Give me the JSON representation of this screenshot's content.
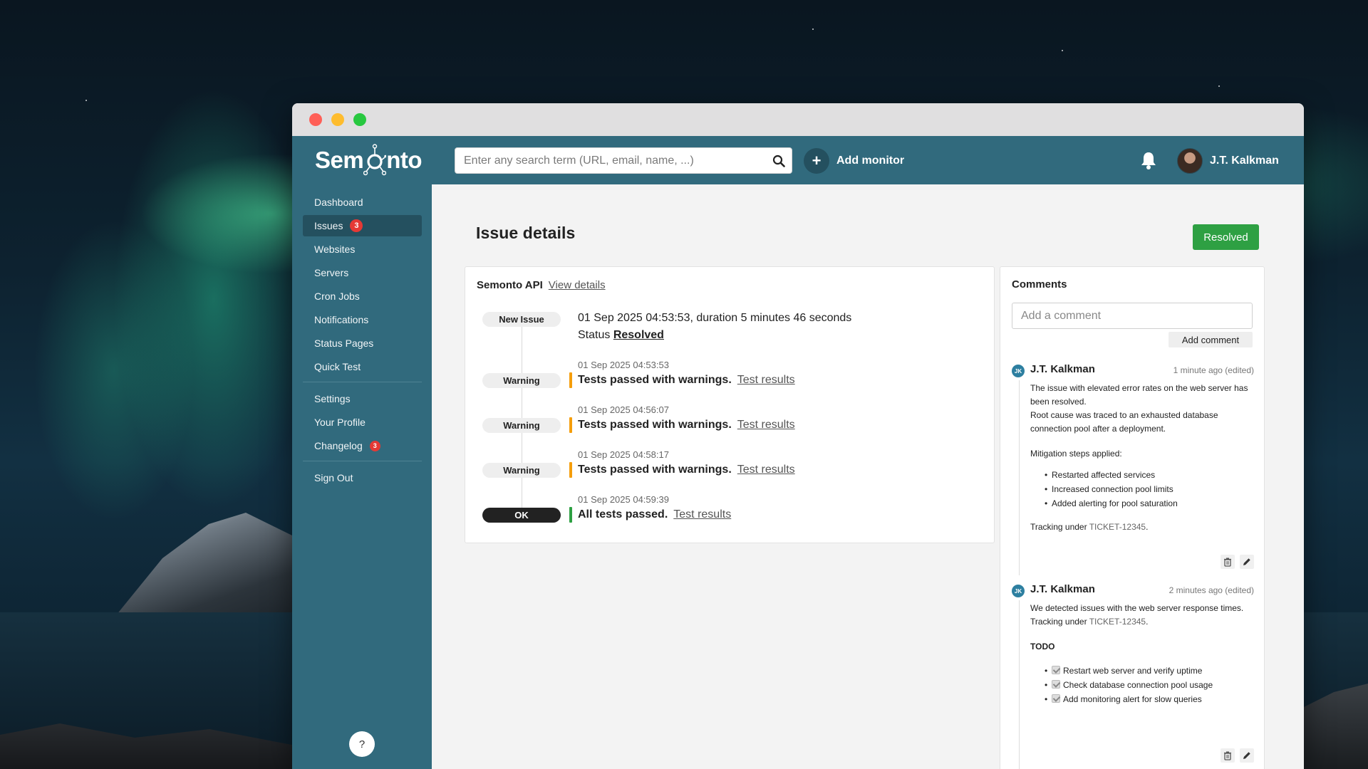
{
  "app": {
    "logo_text_left": "Sem",
    "logo_text_right": "nto"
  },
  "search": {
    "placeholder": "Enter any search term (URL, email, name, ...)",
    "value": ""
  },
  "header": {
    "add_monitor_label": "Add monitor",
    "user_name": "J.T. Kalkman"
  },
  "sidebar": {
    "items": [
      {
        "label": "Dashboard"
      },
      {
        "label": "Issues",
        "badge": "3"
      },
      {
        "label": "Websites"
      },
      {
        "label": "Servers"
      },
      {
        "label": "Cron Jobs"
      },
      {
        "label": "Notifications"
      },
      {
        "label": "Status Pages"
      },
      {
        "label": "Quick Test"
      },
      {
        "label": "Settings"
      },
      {
        "label": "Your Profile"
      },
      {
        "label": "Changelog",
        "badge": "3"
      },
      {
        "label": "Sign Out"
      }
    ],
    "help_label": "?"
  },
  "page": {
    "title": "Issue details",
    "status_button": "Resolved"
  },
  "issue": {
    "monitor_name": "Semonto API",
    "view_details": "View details",
    "header_event": {
      "label": "New Issue",
      "text": "01 Sep 2025 04:53:53, duration 5 minutes 46 seconds",
      "status_prefix": "Status",
      "status_value": "Resolved"
    },
    "events": [
      {
        "label": "Warning",
        "time": "01 Sep 2025 04:53:53",
        "message": "Tests passed with warnings.",
        "link": "Test results"
      },
      {
        "label": "Warning",
        "time": "01 Sep 2025 04:56:07",
        "message": "Tests passed with warnings.",
        "link": "Test results"
      },
      {
        "label": "Warning",
        "time": "01 Sep 2025 04:58:17",
        "message": "Tests passed with warnings.",
        "link": "Test results"
      },
      {
        "label": "OK",
        "time": "01 Sep 2025 04:59:39",
        "message": "All tests passed.",
        "link": "Test results"
      }
    ]
  },
  "comments": {
    "title": "Comments",
    "input_placeholder": "Add a comment",
    "add_button": "Add comment",
    "items": [
      {
        "initials": "JK",
        "author": "J.T. Kalkman",
        "time": "1 minute ago (edited)",
        "line1": "The issue with elevated error rates on the web server has been resolved.",
        "line2": "Root cause was traced to an exhausted database connection pool after a deployment.",
        "mitigation": "Mitigation steps applied:",
        "bullets": [
          "Restarted affected services",
          "Increased connection pool limits",
          "Added alerting for pool saturation"
        ],
        "tracking_prefix": "Tracking under",
        "ticket": "TICKET-12345",
        "tracking_suffix": "."
      },
      {
        "initials": "JK",
        "author": "J.T. Kalkman",
        "time": "2 minutes ago (edited)",
        "line1": "We detected issues with the web server response times.",
        "tracking_prefix": "Tracking under",
        "ticket": "TICKET-12345",
        "tracking_suffix": ".",
        "todo_title": "TODO",
        "todos": [
          "Restart web server and verify uptime",
          "Check database connection pool usage",
          "Add monitoring alert for slow queries"
        ]
      }
    ]
  },
  "colors": {
    "brand": "#316a7d",
    "sidebar_active": "#24505f",
    "resolved_green": "#2ea043",
    "warning_orange": "#f59e0b",
    "badge_red": "#e53935"
  }
}
